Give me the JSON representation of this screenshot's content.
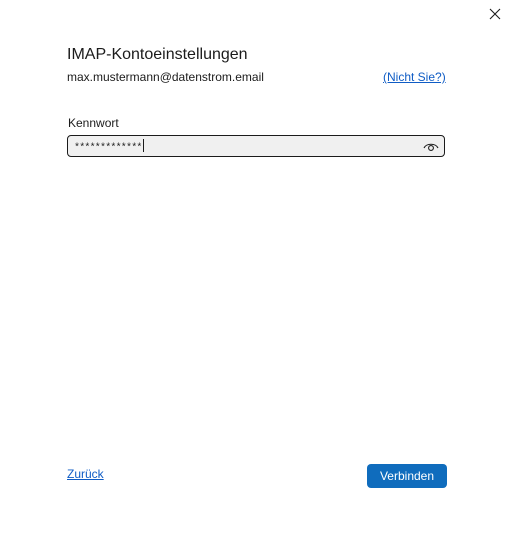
{
  "dialog": {
    "title": "IMAP-Kontoeinstellungen",
    "email": "max.mustermann@datenstrom.email",
    "not_you_link": "(Nicht Sie?)"
  },
  "password": {
    "label": "Kennwort",
    "masked_value": "*************"
  },
  "footer": {
    "back_label": "Zurück",
    "connect_label": "Verbinden"
  },
  "colors": {
    "accent": "#0f6cbd",
    "link": "#0f5cc5",
    "text": "#1b1b1b",
    "field_bg": "#f0f0f0"
  },
  "icons": {
    "close": "close-icon",
    "reveal_password": "eye-icon"
  }
}
